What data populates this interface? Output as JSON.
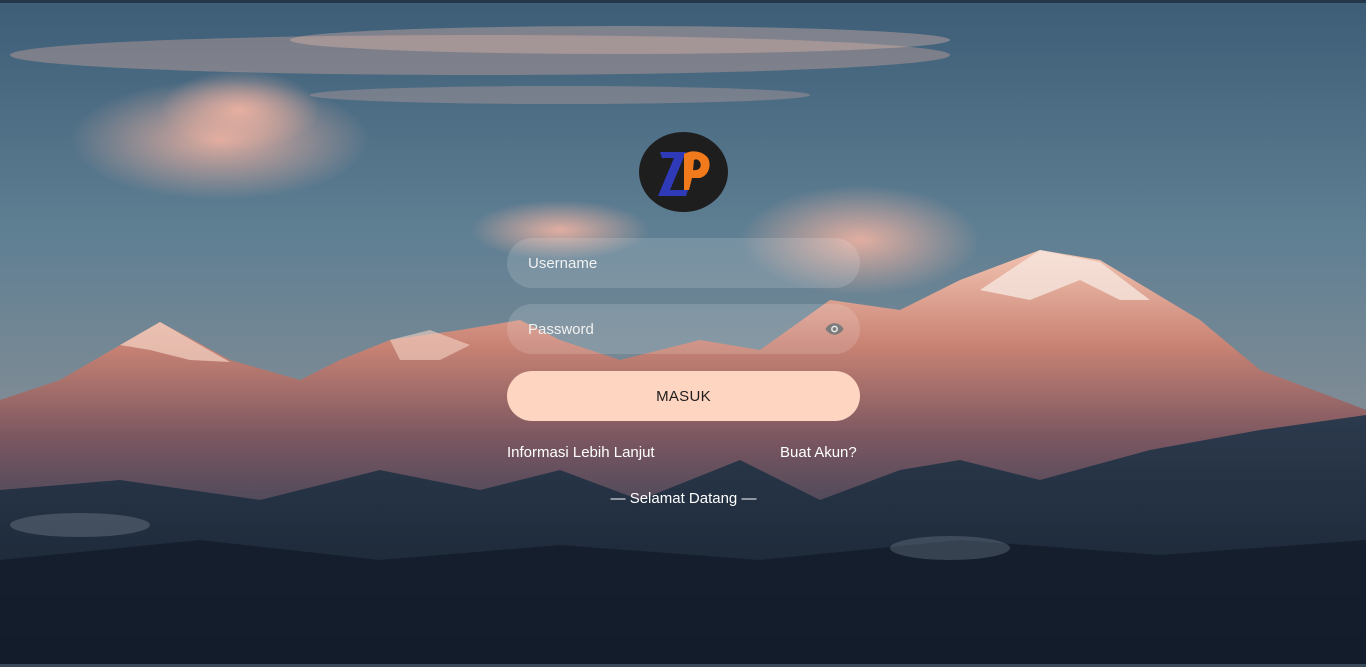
{
  "login": {
    "username_placeholder": "Username",
    "password_placeholder": "Password",
    "submit_label": "MASUK",
    "more_info_link": "Informasi Lebih Lanjut",
    "create_account_link": "Buat Akun?",
    "welcome_text": "— Selamat Datang —",
    "password_toggle_icon": "eye-icon"
  },
  "logo": {
    "icon": "zp-logo-icon",
    "colors": {
      "circle": "#1e1e1f",
      "z": "#2f3ab8",
      "p": "#f07a1c"
    }
  },
  "theme": {
    "button_bg": "#fed5c1",
    "field_bg": "rgba(255,255,255,0.14)",
    "text": "#ffffff"
  }
}
